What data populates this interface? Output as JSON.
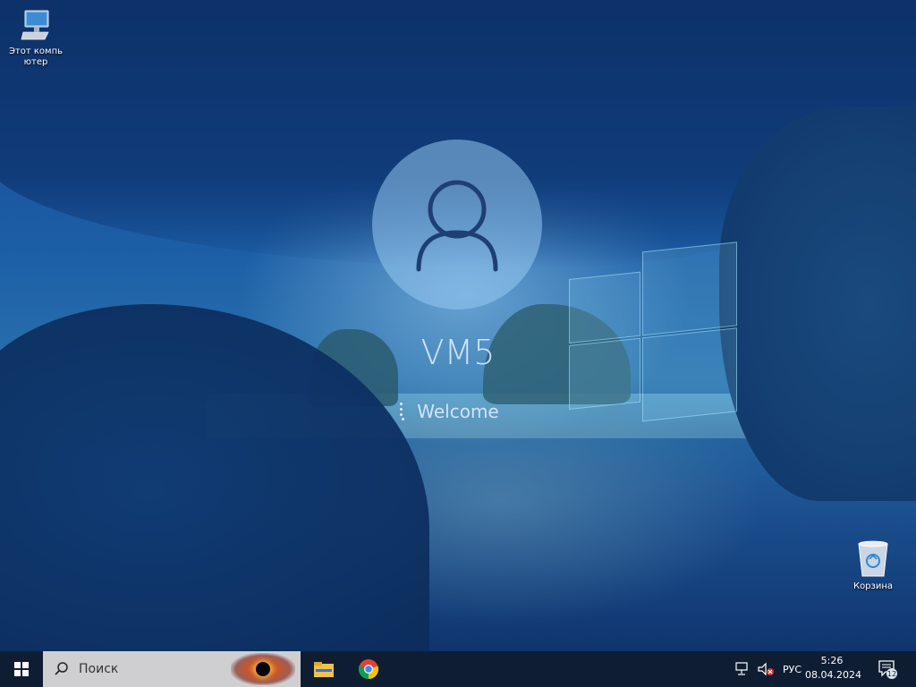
{
  "desktop": {
    "icons": [
      {
        "name": "this-pc",
        "label": "Этот компьютер"
      },
      {
        "name": "recycle-bin",
        "label": "Корзина"
      }
    ]
  },
  "lockscreen": {
    "username": "VM5",
    "status": "Welcome",
    "avatar_icon": "user-icon"
  },
  "taskbar": {
    "start_icon": "windows-logo-icon",
    "search_placeholder": "Поиск",
    "pinned": [
      {
        "name": "file-explorer",
        "icon": "folder-icon"
      },
      {
        "name": "chrome",
        "icon": "chrome-icon"
      }
    ],
    "tray": {
      "language": "РУС",
      "time": "5:26",
      "date": "08.04.2024",
      "notifications_count": "12"
    }
  },
  "colors": {
    "taskbar_bg": "#0f1d33",
    "search_bg": "#cfcfd2",
    "accent": "#1c5ea6"
  }
}
